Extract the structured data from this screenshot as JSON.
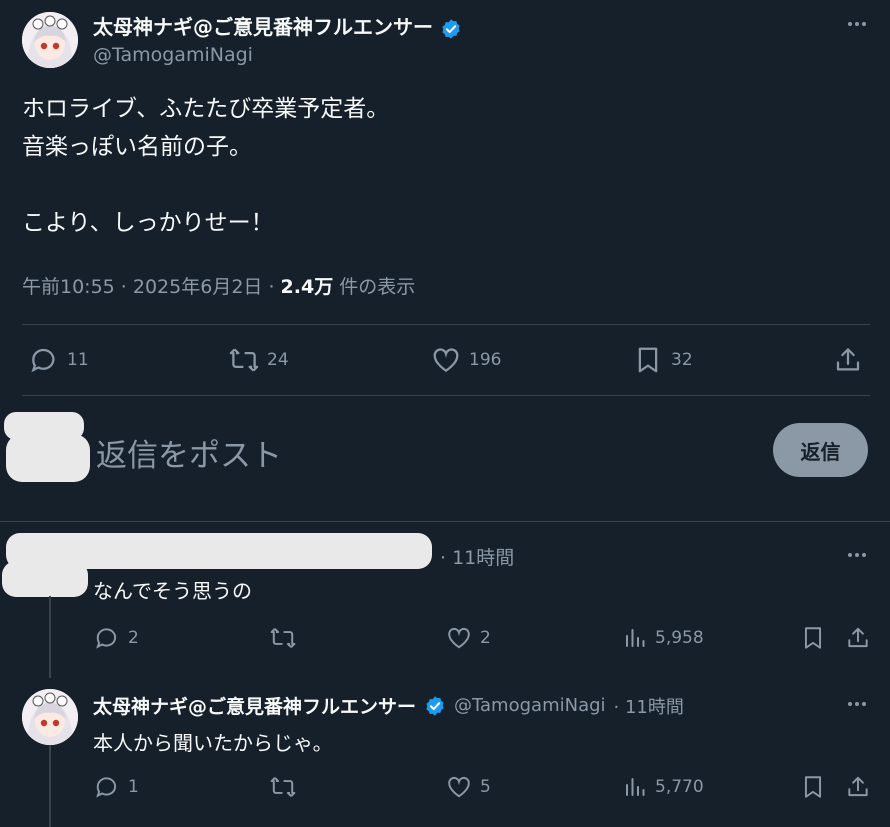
{
  "main_tweet": {
    "display_name": "太母神ナギ@ご意見番神フルエンサー",
    "handle": "@TamogamiNagi",
    "text": "ホロライブ、ふたたび卒業予定者。\n音楽っぽい名前の子。\n\nこより、しっかりせー！",
    "time": "午前10:55 · 2025年6月2日 · ",
    "views_count": "2.4万",
    "views_label": " 件の表示",
    "replies": "11",
    "retweets": "24",
    "likes": "196",
    "bookmarks": "32"
  },
  "composer": {
    "placeholder": "返信をポスト",
    "button_label": "返信"
  },
  "reply_1": {
    "time": "· 11時間",
    "text": "なんでそう思うの",
    "replies": "2",
    "likes": "2",
    "views": "5,958"
  },
  "reply_2": {
    "display_name": "太母神ナギ@ご意見番神フルエンサー",
    "handle": "@TamogamiNagi",
    "time": "· 11時間",
    "text": "本人から聞いたからじゃ。",
    "replies": "1",
    "likes": "5",
    "views": "5,770"
  },
  "colors": {
    "background": "#15202b",
    "text": "#f7f9f9",
    "muted": "#8b98a5",
    "verified": "#1d9bf0",
    "divider": "#38444d"
  }
}
